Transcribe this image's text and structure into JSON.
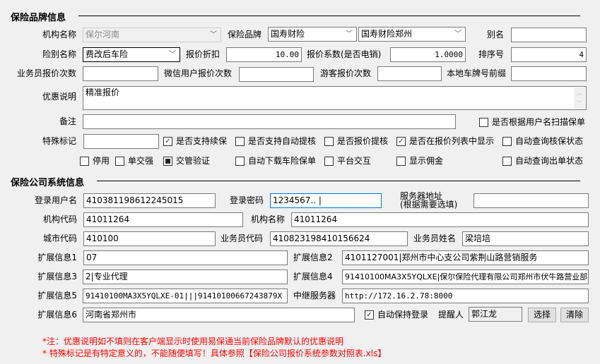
{
  "brand_section": {
    "title": "保险品牌信息",
    "org_name": {
      "label": "机构名称",
      "value": "保尔河南"
    },
    "brand": {
      "label": "保险品牌",
      "value": "国寿财险",
      "sub_value": "国寿财险郑州"
    },
    "alias": {
      "label": "别名",
      "value": ""
    },
    "risk_name": {
      "label": "险别名称",
      "value": "费改后车险"
    },
    "discount": {
      "label": "报价折扣",
      "value": "10.00"
    },
    "coefficient": {
      "label": "报价系数(是否电销)",
      "value": "1.0000"
    },
    "sort_no": {
      "label": "排序号",
      "value": "4"
    },
    "staff_quote_count": {
      "label": "业务员报价次数",
      "value": ""
    },
    "wechat_quote_count": {
      "label": "微信用户报价次数",
      "value": ""
    },
    "guest_quote_count": {
      "label": "游客报价次数",
      "value": ""
    },
    "plate_prefix": {
      "label": "本地车牌号前缀",
      "value": ""
    },
    "promo_desc": {
      "label": "优惠说明",
      "value": "精准报价"
    },
    "remark": {
      "label": "备注",
      "value": ""
    },
    "special_mark": {
      "label": "特殊标记",
      "value": ""
    },
    "checkboxes": [
      {
        "label": "是否根据用户名扫描保单",
        "checked": false
      },
      {
        "label": "是否支持续保",
        "checked": true
      },
      {
        "label": "是否支持自动提核",
        "checked": false
      },
      {
        "label": "是否报价提核",
        "checked": false
      },
      {
        "label": "是否在报价列表中显示",
        "checked": true
      },
      {
        "label": "自动查询核保状态",
        "checked": false
      },
      {
        "label": "停用",
        "checked": false
      },
      {
        "label": "单交强",
        "checked": false
      },
      {
        "label": "交管验证",
        "checked": "indeterminate"
      },
      {
        "label": "自动下载车险保单",
        "checked": false
      },
      {
        "label": "平台交互",
        "checked": false
      },
      {
        "label": "显示佣金",
        "checked": false
      },
      {
        "label": "自动查询出单状态",
        "checked": false
      }
    ]
  },
  "system_section": {
    "title": "保险公司系统信息",
    "login_user": {
      "label": "登录用户名",
      "value": "410381198612245015"
    },
    "login_pwd": {
      "label": "登录密码",
      "value": "1234567.. |"
    },
    "server_addr": {
      "label": "服务器地址",
      "label2": "(根据需要选填)",
      "value": ""
    },
    "org_code": {
      "label": "机构代码",
      "value": "41011264"
    },
    "org_name": {
      "label": "机构名称",
      "value": "41011264"
    },
    "city_code": {
      "label": "城市代码",
      "value": "410100"
    },
    "staff_code": {
      "label": "业务员代码",
      "value": "410823198410156624"
    },
    "staff_name": {
      "label": "业务员姓名",
      "value": "梁培培"
    },
    "ext1": {
      "label": "扩展信息1",
      "value": "07"
    },
    "ext2": {
      "label": "扩展信息2",
      "value": "4101127001|郑州市中心支公司紫荆山路营销服务"
    },
    "ext3": {
      "label": "扩展信息3",
      "value": "2|专业代理"
    },
    "ext4": {
      "label": "扩展信息4",
      "value": "91410100MA3X5YQLXE|保尔保险代理有限公司郑州市伏牛路营业部"
    },
    "ext5": {
      "label": "扩展信息5",
      "value": "91410100MA3X5YQLXE-01|||91410100667243879X"
    },
    "relay": {
      "label": "中继服务器",
      "value": "http://172.16.2.78:8000"
    },
    "ext6": {
      "label": "扩展信息6",
      "value": "河南省郑州市"
    },
    "auto_login": {
      "label": "自动保持登录",
      "checked": true
    },
    "reminder": {
      "label": "提醒人",
      "value": "郭江龙"
    },
    "select_btn": "选择",
    "clear_btn": "清除"
  },
  "notes": [
    "*注：优惠说明如不填则在客户端显示时使用易保通当前保险品牌默认的优惠说明",
    "* 特殊标记是有特定意义的，不能随便填写！具体参照【保险公司报价系统参数对照表.xls】"
  ],
  "colors": {
    "note": "#ff0000",
    "focus_border": "#0078d7"
  }
}
